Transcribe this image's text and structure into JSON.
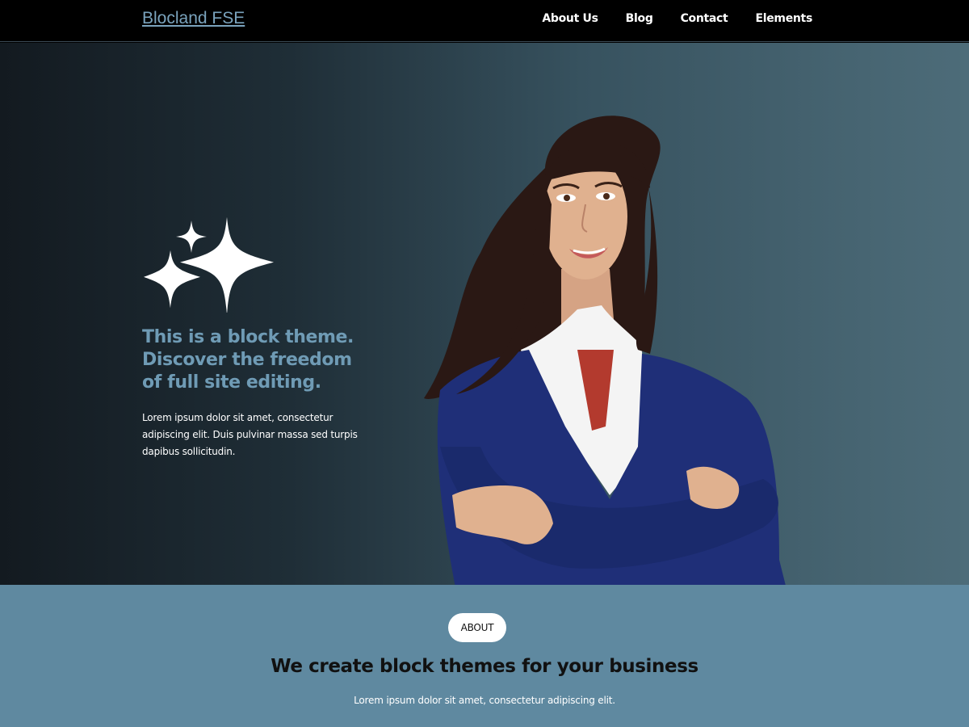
{
  "header": {
    "brand": "Blocland FSE",
    "nav": [
      "About Us",
      "Blog",
      "Contact",
      "Elements"
    ]
  },
  "hero": {
    "heading": "This is a block theme. Discover the freedom of full site editing.",
    "text": "Lorem ipsum dolor sit amet, consectetur adipiscing elit. Duis pulvinar massa sed turpis dapibus sollicitudin.",
    "sparkles_icon": "sparkles-icon",
    "image": "woman-portrait"
  },
  "about": {
    "badge": "ABOUT",
    "title": "We create block themes for your business",
    "text": "Lorem ipsum dolor sit amet, consectetur adipiscing elit."
  },
  "colors": {
    "header_bg": "#000000",
    "brand": "#7aa3bd",
    "hero_heading": "#6f9bb5",
    "about_bg": "#5f89a0",
    "cardigan": "#1f2f78"
  }
}
